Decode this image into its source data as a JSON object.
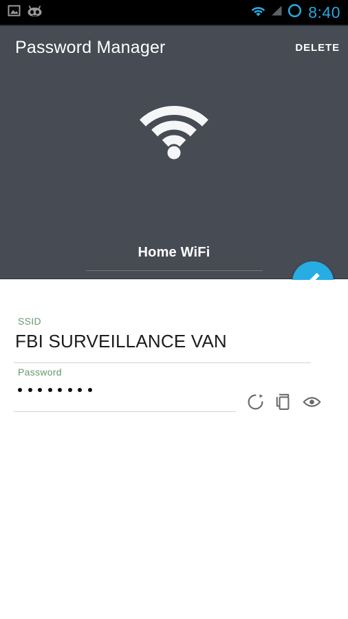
{
  "status_bar": {
    "background": "#000000",
    "accent": "#2aa8dd",
    "time": "8:40",
    "left_icons": [
      "photo-icon",
      "cyanogenmod-icon"
    ],
    "right_icons": [
      "wifi-signal-icon",
      "cellular-signal-icon",
      "circle-ring-icon"
    ]
  },
  "app_bar": {
    "title": "Password Manager",
    "delete_label": "DELETE",
    "background": "#464b54",
    "title_color": "#ffffff"
  },
  "hero": {
    "icon": "wifi-icon",
    "entry_name": "Home WiFi",
    "entry_type": "WIFI",
    "divider_color": "#6d7a6f"
  },
  "fab": {
    "icon": "pencil-edit-icon",
    "color": "#27ade4",
    "icon_color": "#ffffff"
  },
  "form": {
    "ssid": {
      "label": "SSID",
      "value": "FBI SURVEILLANCE VAN",
      "label_color": "#68966c",
      "underline_color": "#c9d7c9"
    },
    "password": {
      "label": "Password",
      "masked_value": "••••••••",
      "mask_dot_count": 8,
      "label_color": "#68966c",
      "underline_color": "#c9d7c9",
      "actions": [
        {
          "name": "regenerate-icon",
          "label": "Regenerate"
        },
        {
          "name": "copy-icon",
          "label": "Copy"
        },
        {
          "name": "eye-reveal-icon",
          "label": "Show password"
        }
      ]
    }
  }
}
